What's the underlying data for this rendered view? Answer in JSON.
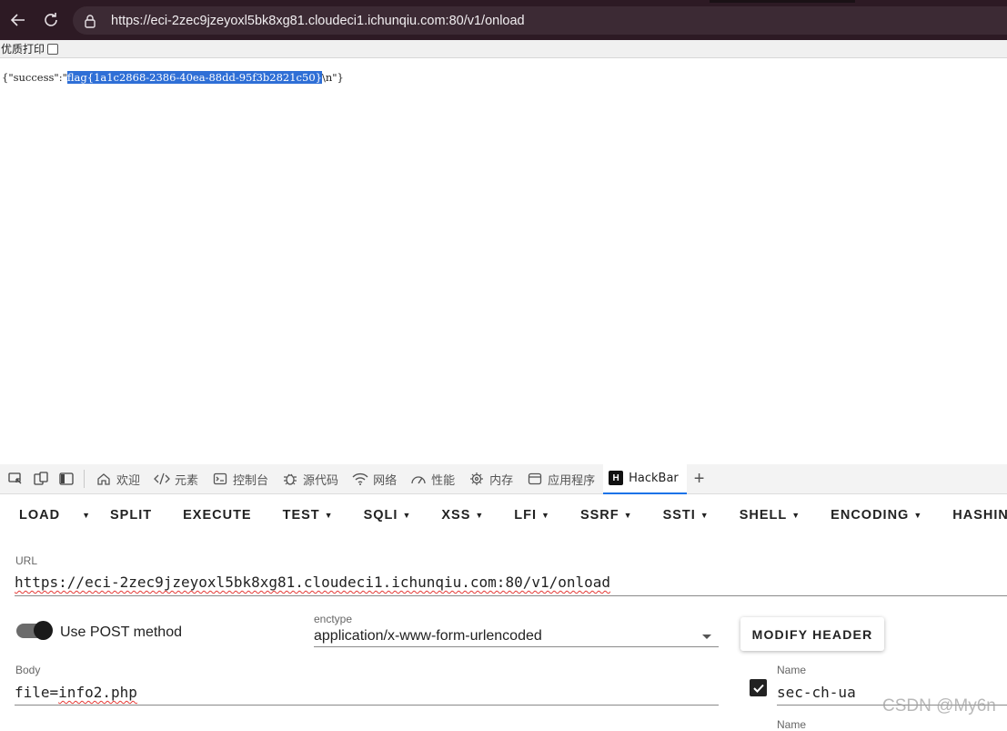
{
  "browser": {
    "url": "https://eci-2zec9jzeyoxl5bk8xg81.cloudeci1.ichunqiu.com:80/v1/onload"
  },
  "print_bar": {
    "label": "优质打印"
  },
  "page": {
    "json_prefix": "{\"success\":\"",
    "json_selected": "flag{1a1c2868-2386-40ea-88dd-95f3b2821c50}",
    "json_suffix": "\\n\"}"
  },
  "devtools": {
    "tabs": [
      {
        "label": "欢迎",
        "icon": "home-icon"
      },
      {
        "label": "元素",
        "icon": "code-icon"
      },
      {
        "label": "控制台",
        "icon": "console-icon"
      },
      {
        "label": "源代码",
        "icon": "bug-icon"
      },
      {
        "label": "网络",
        "icon": "wifi-icon"
      },
      {
        "label": "性能",
        "icon": "gauge-icon"
      },
      {
        "label": "内存",
        "icon": "chip-icon"
      },
      {
        "label": "应用程序",
        "icon": "window-icon"
      },
      {
        "label": "HackBar",
        "icon": "hackbar-logo-icon",
        "active": true
      }
    ]
  },
  "hackbar": {
    "menu": {
      "load": "LOAD",
      "split": "SPLIT",
      "execute": "EXECUTE",
      "test": "TEST",
      "sqli": "SQLI",
      "xss": "XSS",
      "lfi": "LFI",
      "ssrf": "SSRF",
      "ssti": "SSTI",
      "shell": "SHELL",
      "encoding": "ENCODING",
      "hashing": "HASHING"
    },
    "url_label": "URL",
    "url_value": "https://eci-2zec9jzeyoxl5bk8xg81.cloudeci1.ichunqiu.com:80/v1/onload",
    "post_toggle_label": "Use POST method",
    "post_enabled": true,
    "enctype_label": "enctype",
    "enctype_value": "application/x-www-form-urlencoded",
    "modify_header_label": "MODIFY HEADER",
    "body_label": "Body",
    "body_value": "file=info2.php",
    "header_name_label": "Name",
    "header_name_value": "sec-ch-ua",
    "header_enabled": true,
    "header_name_label_2": "Name"
  },
  "watermark": "CSDN @My6n"
}
